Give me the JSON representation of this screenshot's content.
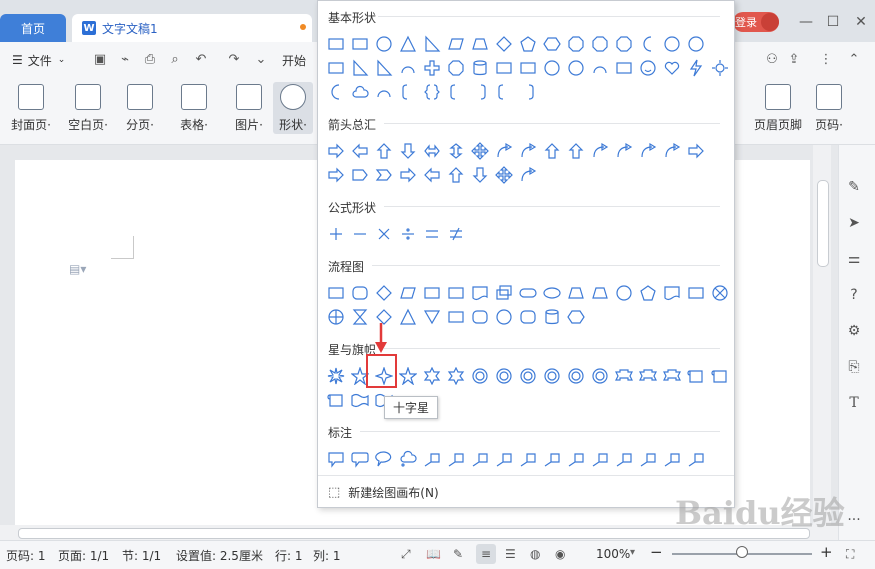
{
  "tabs": {
    "home": "首页",
    "document": "文字文稿1",
    "doc_icon": "W",
    "login": "登录"
  },
  "window": {
    "minimize": "—",
    "maximize": "☐",
    "close": "✕"
  },
  "menubar": {
    "file": "文件",
    "start": "开始"
  },
  "ribbon": {
    "cover": "封面页·",
    "blank": "空白页·",
    "section": "分页·",
    "table": "表格·",
    "picture": "图片·",
    "shape": "形状·",
    "header_footer": "页眉页脚",
    "page_number": "页码·"
  },
  "shapes_panel": {
    "sections": {
      "basic": "基本形状",
      "arrows": "箭头总汇",
      "formula": "公式形状",
      "flowchart": "流程图",
      "stars": "星与旗帜",
      "callouts": "标注"
    },
    "tooltip": "十字星",
    "new_canvas": "新建绘图画布(N)"
  },
  "statusbar": {
    "page": "页码: 1",
    "pages": "页面: 1/1",
    "section": "节: 1/1",
    "setting": "设置值: 2.5厘米",
    "row": "行: 1",
    "col": "列: 1",
    "zoom": "100%",
    "zoom_fraction": 0.5
  },
  "colors": {
    "accent": "#3f7fd8",
    "shape_stroke": "#3d7ad6",
    "highlight": "#e23a3a"
  },
  "watermark": "Baidu经验"
}
